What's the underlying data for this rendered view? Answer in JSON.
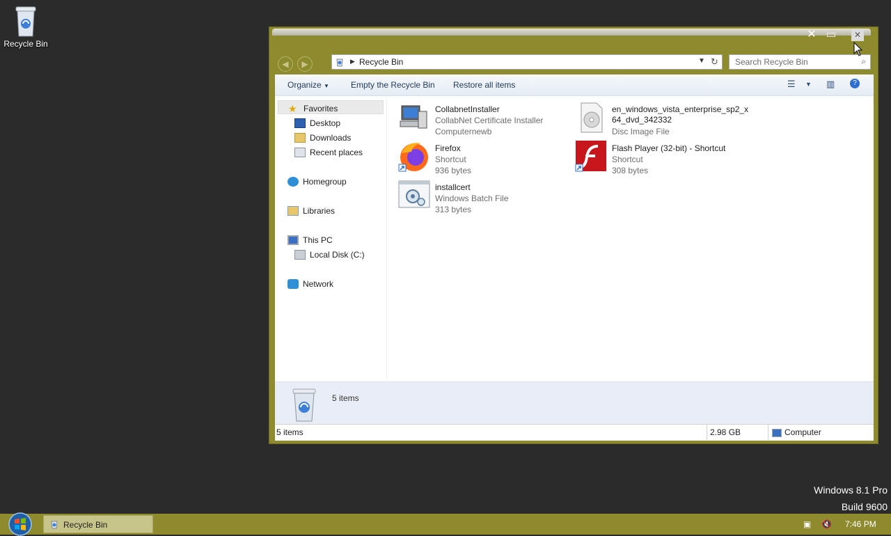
{
  "desktop": {
    "recycle_bin_label": "Recycle Bin",
    "watermark_line1": "Windows 8.1 Pro",
    "watermark_line2": "Build 9600"
  },
  "window": {
    "address": {
      "path": "Recycle Bin"
    },
    "search": {
      "placeholder": "Search Recycle Bin"
    },
    "toolbar": {
      "organize": "Organize",
      "empty": "Empty the Recycle Bin",
      "restore": "Restore all items"
    },
    "nav": {
      "favorites": "Favorites",
      "desktop": "Desktop",
      "downloads": "Downloads",
      "recent": "Recent places",
      "homegroup": "Homegroup",
      "libraries": "Libraries",
      "thispc": "This PC",
      "localdisk": "Local Disk (C:)",
      "network": "Network"
    },
    "files": [
      {
        "name": "CollabnetInstaller",
        "line2": "CollabNet Certificate Installer",
        "line3": "Computernewb",
        "icon": "computer-installer-icon"
      },
      {
        "name": "en_windows_vista_enterprise_sp2_x",
        "name2": "64_dvd_342332",
        "line2": "Disc Image File",
        "icon": "disc-image-icon"
      },
      {
        "name": "Firefox",
        "line2": "Shortcut",
        "line3": "936 bytes",
        "icon": "firefox-icon"
      },
      {
        "name": "Flash Player (32-bit) - Shortcut",
        "line2": "Shortcut",
        "line3": "308 bytes",
        "icon": "flash-player-icon"
      },
      {
        "name": "installcert",
        "line2": "Windows Batch File",
        "line3": "313 bytes",
        "icon": "batch-file-icon"
      }
    ],
    "details": {
      "count": "5 items"
    },
    "status": {
      "items": "5 items",
      "size": "2.98 GB",
      "location": "Computer"
    }
  },
  "taskbar": {
    "app_label": "Recycle Bin",
    "clock": "7:46 PM"
  },
  "colors": {
    "accent": "#8e8a2e",
    "taskbar_app": "#c7c48a"
  }
}
